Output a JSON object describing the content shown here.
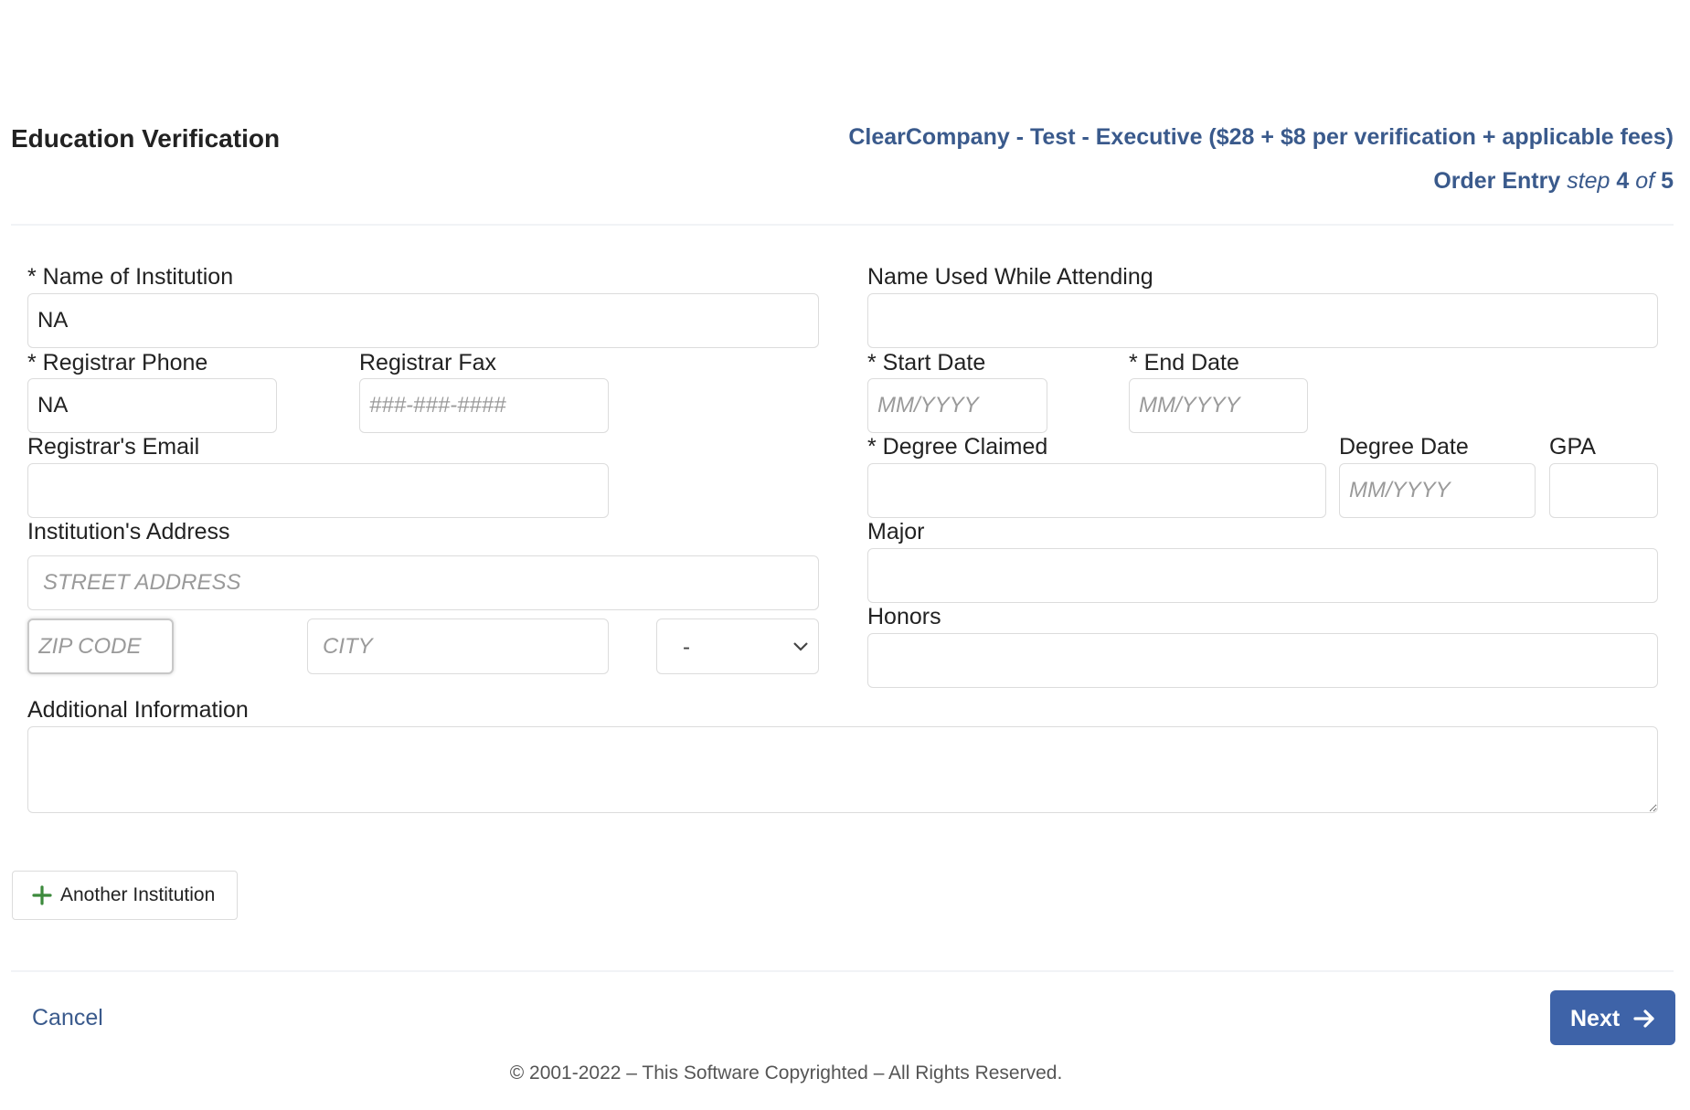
{
  "header": {
    "title": "Education Verification",
    "package": "ClearCompany - Test - Executive ($28 + $8 per verification + applicable fees)",
    "step": {
      "label": "Order Entry",
      "word": "step",
      "current": "4",
      "of": "of",
      "total": "5"
    }
  },
  "form": {
    "institution_name": {
      "label": "* Name of Institution",
      "value": "NA"
    },
    "name_used": {
      "label": "Name Used While Attending",
      "value": ""
    },
    "registrar_phone": {
      "label": "* Registrar Phone",
      "value": "NA"
    },
    "registrar_fax": {
      "label": "Registrar Fax",
      "placeholder": "###-###-####"
    },
    "start_date": {
      "label": "* Start Date",
      "placeholder": "MM/YYYY"
    },
    "end_date": {
      "label": "* End Date",
      "placeholder": "MM/YYYY"
    },
    "registrar_email": {
      "label": "Registrar's Email",
      "value": ""
    },
    "degree_claimed": {
      "label": "* Degree Claimed",
      "value": ""
    },
    "degree_date": {
      "label": "Degree Date",
      "placeholder": "MM/YYYY"
    },
    "gpa": {
      "label": "GPA",
      "value": ""
    },
    "address": {
      "label": "Institution's Address",
      "street_placeholder": "STREET ADDRESS",
      "zip_placeholder": "ZIP CODE",
      "city_placeholder": "CITY",
      "state_selected": "-"
    },
    "major": {
      "label": "Major",
      "value": ""
    },
    "honors": {
      "label": "Honors",
      "value": ""
    },
    "additional_info": {
      "label": "Additional Information",
      "value": ""
    }
  },
  "actions": {
    "add_institution": "Another Institution",
    "cancel": "Cancel",
    "next": "Next"
  },
  "footer": {
    "copyright": "© 2001-2022 – This Software Copyrighted – All Rights Reserved."
  },
  "colors": {
    "accent": "#3e63a8",
    "link": "#3a5a8c",
    "add_icon": "#3c8a3c"
  },
  "icons": {
    "add": "plus-icon",
    "next": "arrow-right-icon",
    "select": "chevron-down-icon"
  }
}
